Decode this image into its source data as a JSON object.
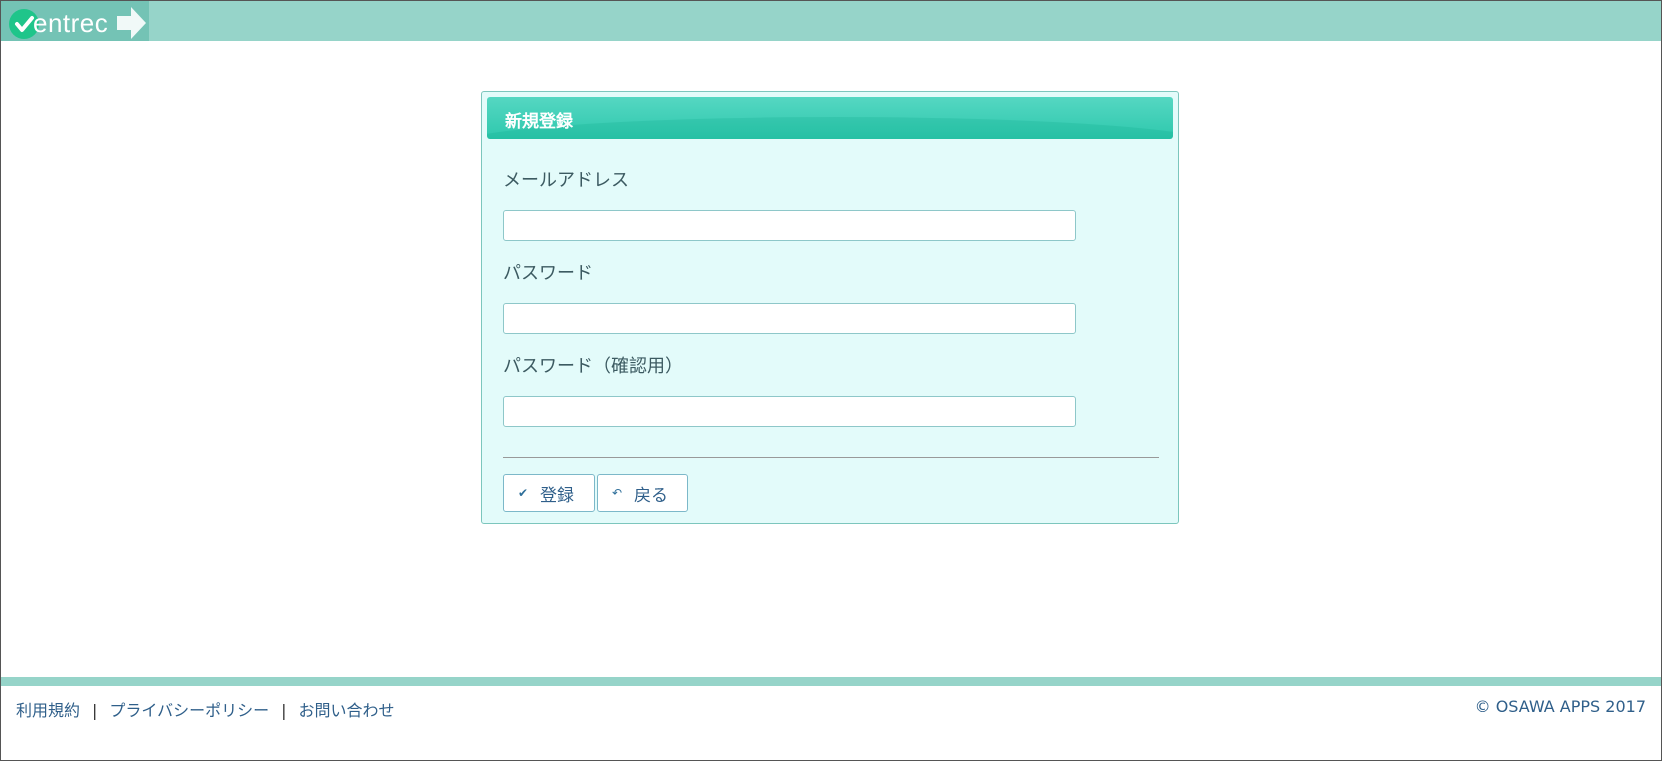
{
  "header": {
    "logo_text": "entrec",
    "logo_icon": "check-circle-icon"
  },
  "form": {
    "title": "新規登録",
    "email_label": "メールアドレス",
    "email_value": "",
    "password_label": "パスワード",
    "password_value": "",
    "password_confirm_label": "パスワード（確認用）",
    "password_confirm_value": "",
    "register_button": "登録",
    "register_icon": "check-icon",
    "back_button": "戻る",
    "back_icon": "undo-arrow-icon"
  },
  "footer": {
    "links": [
      "利用規約",
      "プライバシーポリシー",
      "お問い合わせ"
    ],
    "separator": "|",
    "copyright": "© OSAWA APPS 2017"
  },
  "colors": {
    "header_bg": "#96d4c9",
    "panel_bg": "#e3fbfa",
    "panel_header": "#2ec8ad",
    "link": "#2f5f8a"
  }
}
